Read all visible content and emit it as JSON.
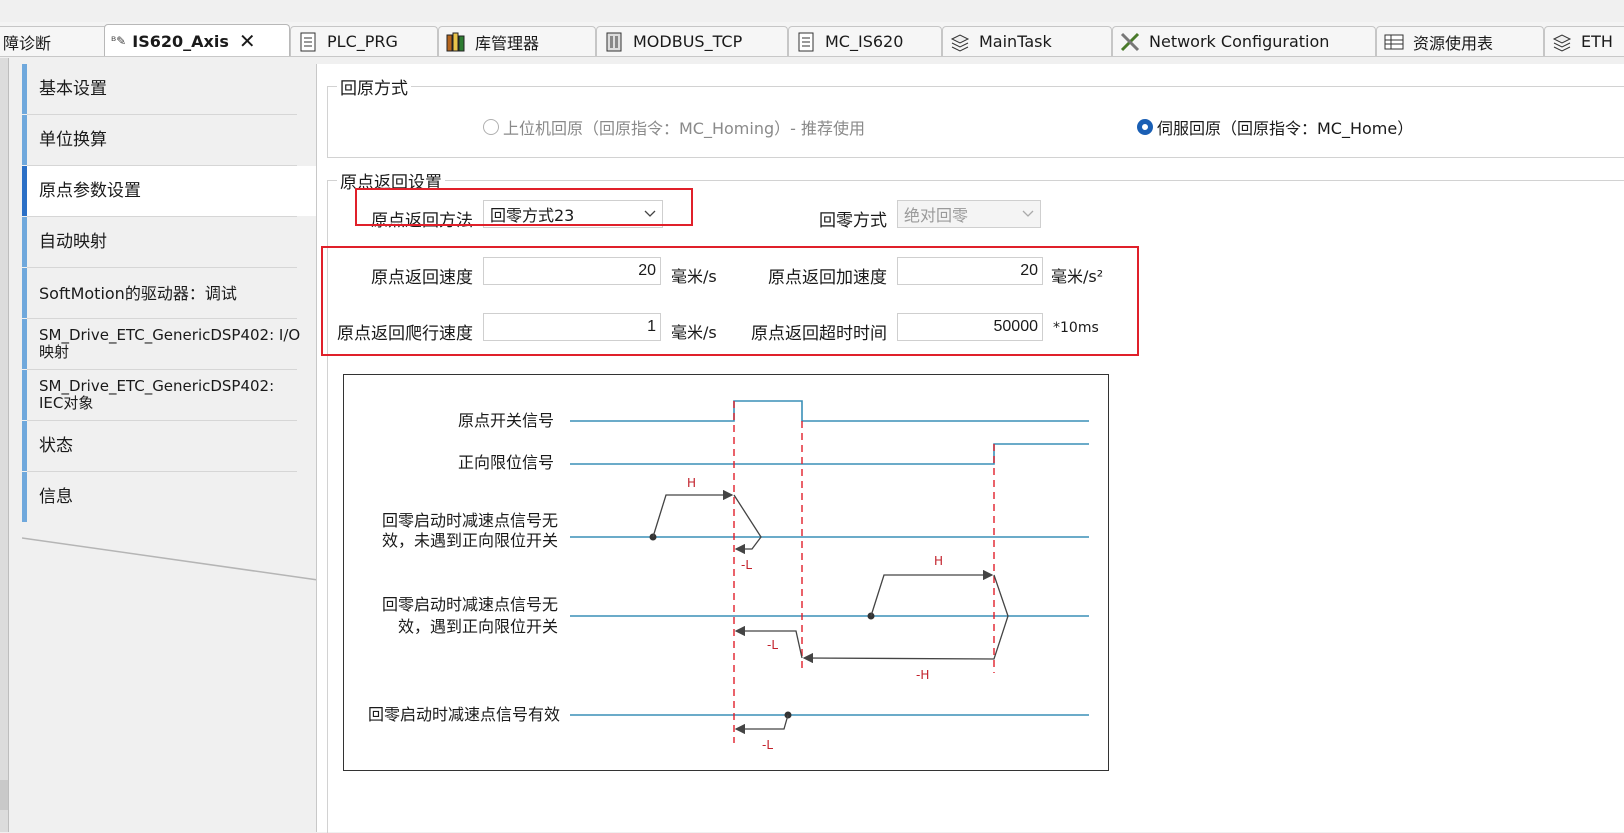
{
  "tabs": [
    {
      "label": "障诊断",
      "icon": "none"
    },
    {
      "label": "IS620_Axis",
      "icon": "axis-icon",
      "active": true
    },
    {
      "label": "PLC_PRG",
      "icon": "document-icon"
    },
    {
      "label": "库管理器",
      "icon": "library-icon"
    },
    {
      "label": "MODBUS_TCP",
      "icon": "device-icon"
    },
    {
      "label": "MC_IS620",
      "icon": "document-icon"
    },
    {
      "label": "MainTask",
      "icon": "task-icon"
    },
    {
      "label": "Network Configuration",
      "icon": "network-icon"
    },
    {
      "label": "资源使用表",
      "icon": "table-icon"
    },
    {
      "label": "ETH",
      "icon": "task-icon"
    }
  ],
  "tab_close_glyph": "✕",
  "sidebar": {
    "items": [
      {
        "label": "基本设置"
      },
      {
        "label": "单位换算"
      },
      {
        "label": "原点参数设置",
        "active": true
      },
      {
        "label": "自动映射"
      },
      {
        "label": "SoftMotion的驱动器：调试"
      },
      {
        "label": "SM_Drive_ETC_GenericDSP402: I/O 映射"
      },
      {
        "label": "SM_Drive_ETC_GenericDSP402: IEC对象"
      },
      {
        "label": "状态"
      },
      {
        "label": "信息"
      }
    ]
  },
  "homing_mode": {
    "title": "回原方式",
    "option_host": "上位机回原（回原指令：MC_Homing）- 推荐使用",
    "option_servo": "伺服回原（回原指令：MC_Home）",
    "selected": "servo"
  },
  "homing_settings": {
    "title": "原点返回设置",
    "method_label": "原点返回方法",
    "method_value": "回零方式23",
    "zero_mode_label": "回零方式",
    "zero_mode_value": "绝对回零",
    "speed_label": "原点返回速度",
    "speed_value": "20",
    "speed_unit": "毫米/s",
    "accel_label": "原点返回加速度",
    "accel_value": "20",
    "accel_unit": "毫米/s²",
    "creep_label": "原点返回爬行速度",
    "creep_value": "1",
    "creep_unit": "毫米/s",
    "timeout_label": "原点返回超时时间",
    "timeout_value": "50000",
    "timeout_unit": "*10ms"
  },
  "diagram": {
    "row_home_switch": "原点开关信号",
    "row_pos_limit": "正向限位信号",
    "row_case1_l1": "回零启动时减速点信号无",
    "row_case1_l2": "效，未遇到正向限位开关",
    "row_case2_l1": "回零启动时减速点信号无",
    "row_case2_l2": "效，遇到正向限位开关",
    "row_case3": "回零启动时减速点信号有效",
    "mark_h": "H",
    "mark_neg_l": "-L",
    "mark_neg_h": "-H"
  },
  "colors": {
    "accent_blue": "#2b6fc6",
    "highlight_red": "#e0202a",
    "signal_line": "#3a8fb7"
  }
}
